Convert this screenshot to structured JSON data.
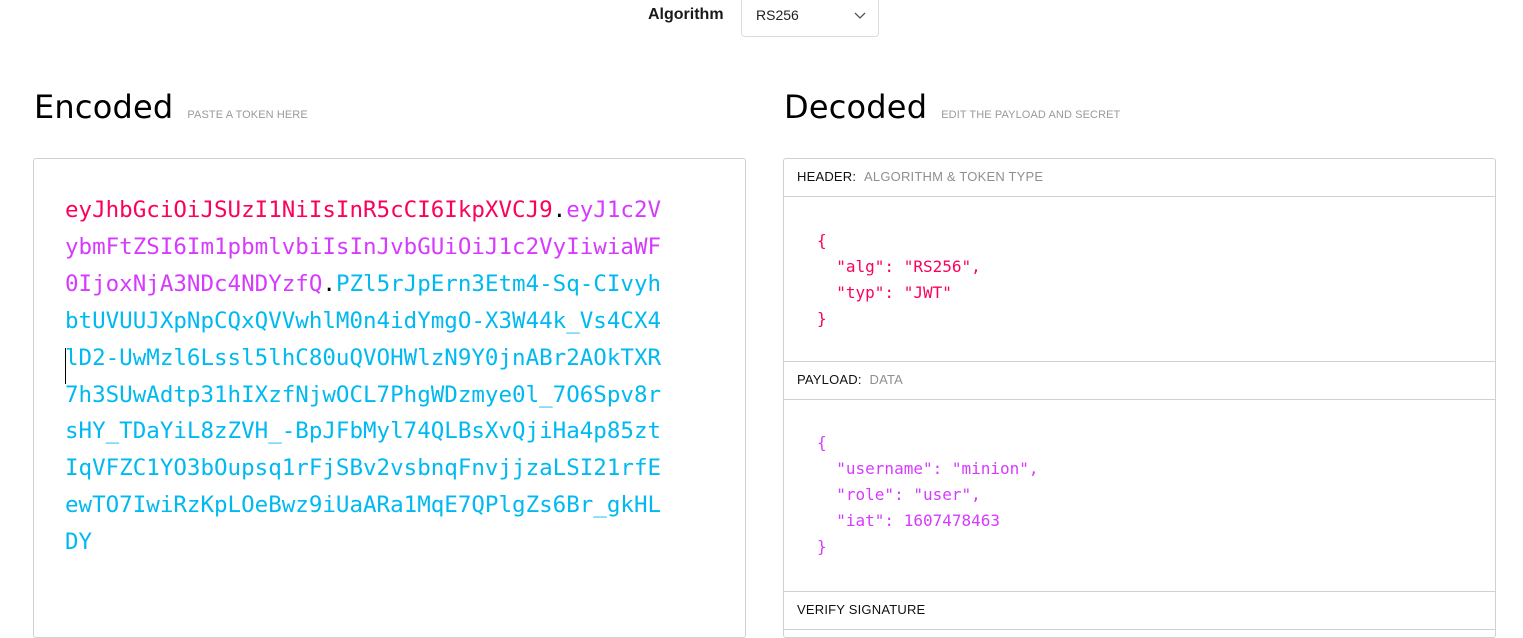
{
  "algorithm": {
    "label": "Algorithm",
    "selected": "RS256"
  },
  "encoded": {
    "title": "Encoded",
    "hint": "PASTE A TOKEN HERE",
    "token": {
      "header": "eyJhbGciOiJSUzI1NiIsInR5cCI6IkpXVCJ9",
      "dot1": ".",
      "payload": "eyJ1c2VybmFtZSI6Im1pbmlvbiIsInJvbGUiOiJ1c2VyIiwiaWF0IjoxNjA3NDc4NDYzfQ",
      "dot2": ".",
      "signature": "PZl5rJpErn3Etm4-Sq-CIvyhbtUVUUJXpNpCQxQVVwhlM0n4idYmgO-X3W44k_Vs4CX4lD2-UwMzl6Lssl5lhC80uQVOHWlzN9Y0jnABr2AOkTXR7h3SUwAdtp31hIXzfNjwOCL7PhgWDzmye0l_7O6Spv8rsHY_TDaYiL8zZVH_-BpJFbMyl74QLBsXvQjiHa4p85ztIqVFZC1YO3bOupsq1rFjSBv2vsbnqFnvjjzaLSI21rfEewTO7IwiRzKpLOeBwz9iUaARa1MqE7QPlgZs6Br_gkHLDY"
    }
  },
  "decoded": {
    "title": "Decoded",
    "hint": "EDIT THE PAYLOAD AND SECRET",
    "header_section": {
      "label": "HEADER:",
      "sublabel": "ALGORITHM & TOKEN TYPE",
      "json": "{\n  \"alg\": \"RS256\",\n  \"typ\": \"JWT\"\n}"
    },
    "payload_section": {
      "label": "PAYLOAD:",
      "sublabel": "DATA",
      "json": "{\n  \"username\": \"minion\",\n  \"role\": \"user\",\n  \"iat\": 1607478463\n}"
    },
    "verify_section": {
      "label": "VERIFY SIGNATURE"
    }
  },
  "colors": {
    "header": "#fb015b",
    "payload": "#d63aff",
    "signature": "#00b9f1"
  }
}
